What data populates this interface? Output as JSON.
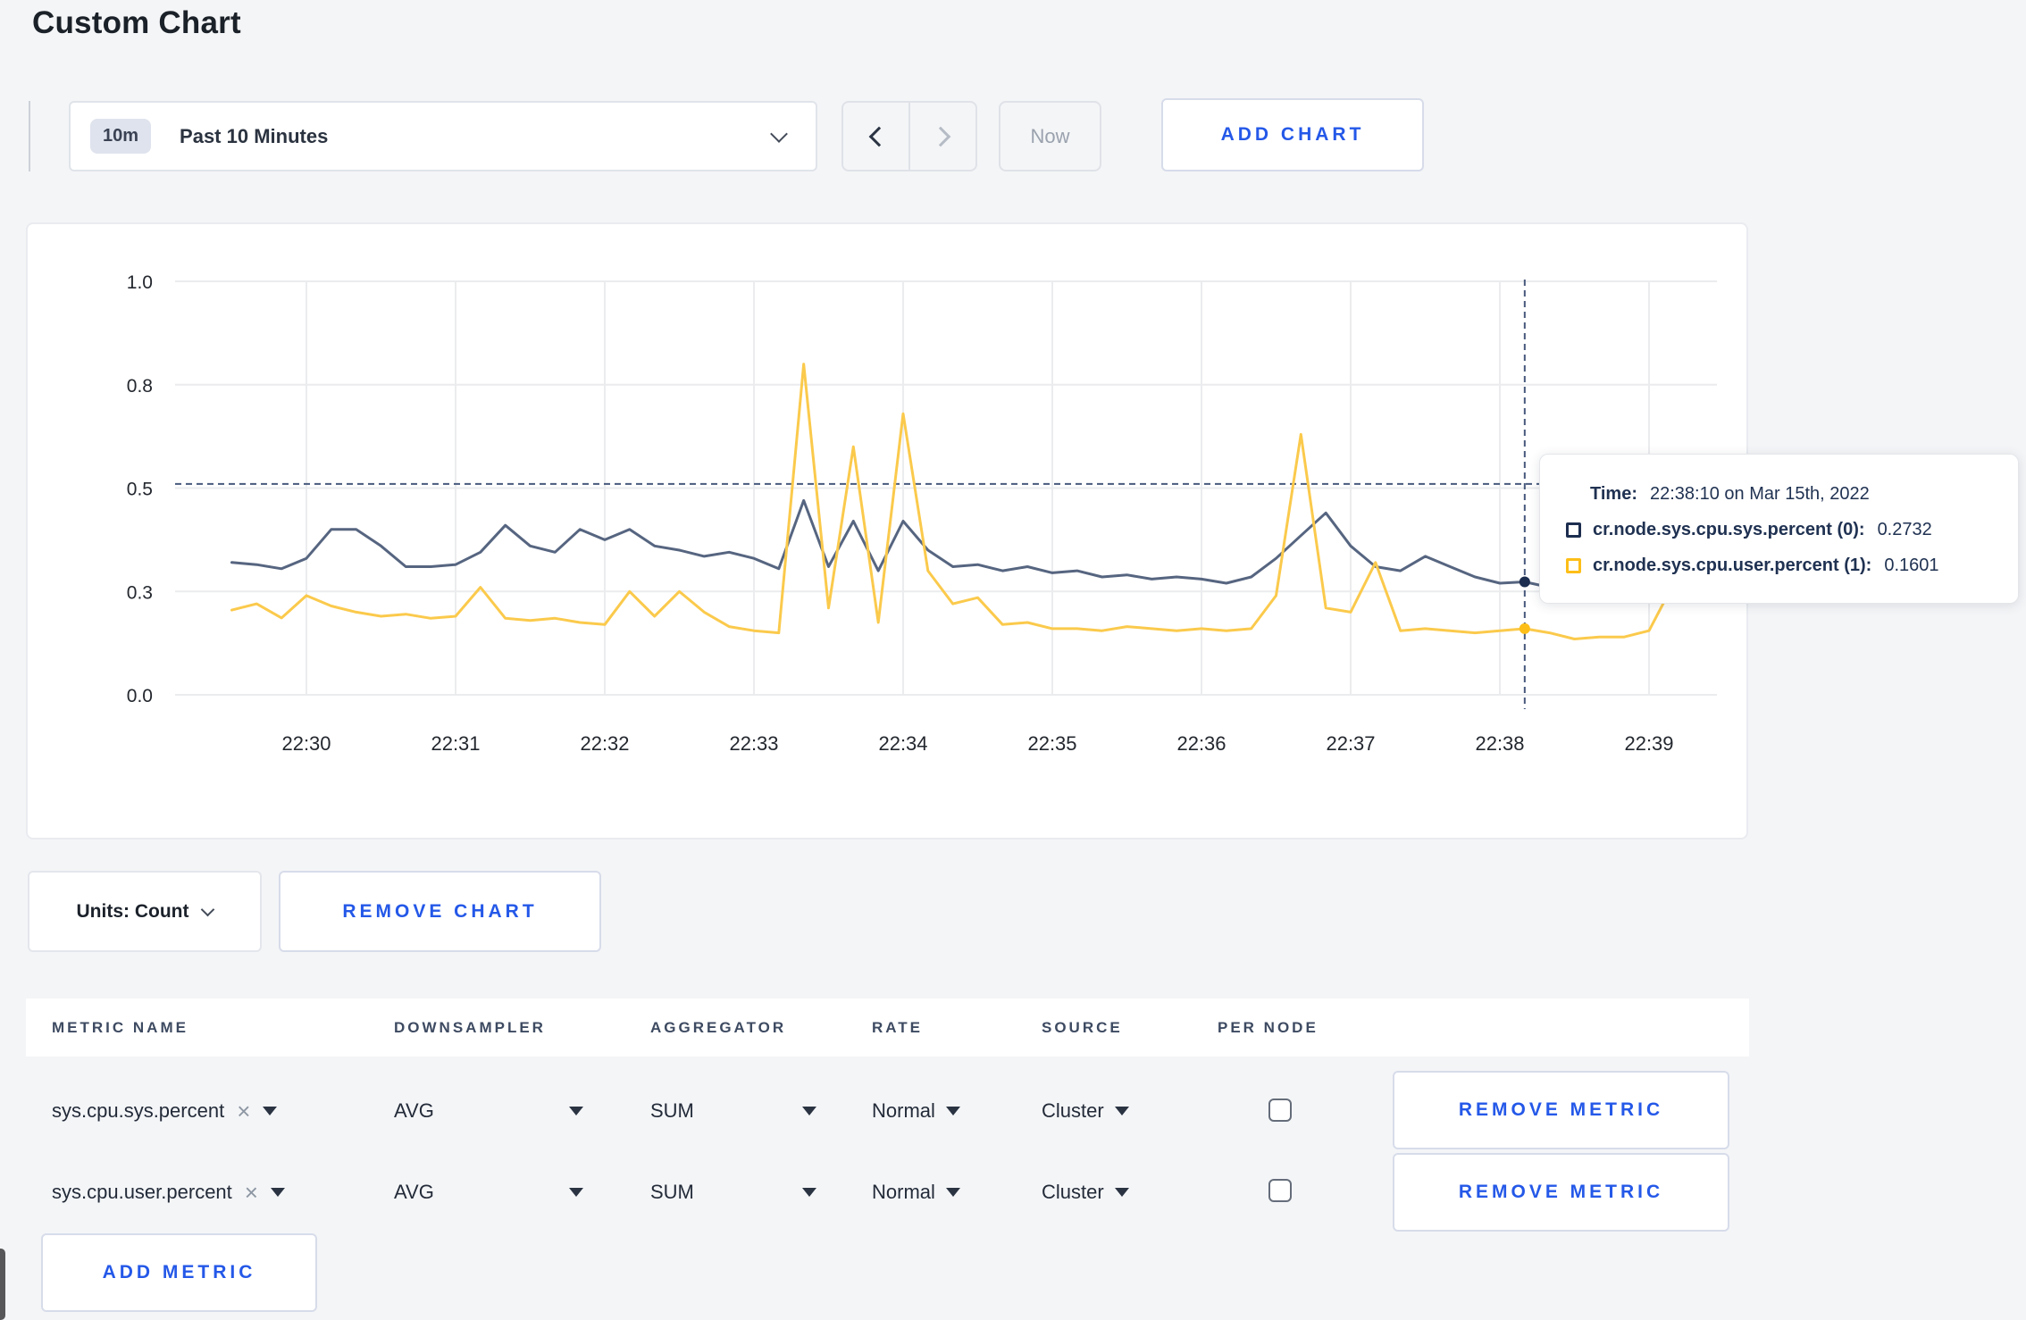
{
  "page": {
    "title": "Custom Chart"
  },
  "toolbar": {
    "time_range_badge": "10m",
    "time_range_label": "Past 10 Minutes",
    "now_label": "Now",
    "add_chart_label": "ADD CHART"
  },
  "chart_data": {
    "type": "line",
    "title": "",
    "xlabel": "",
    "ylabel": "",
    "x_start": "22:29:30",
    "x_step_seconds": 10,
    "x_tick_labels": [
      "22:30",
      "22:31",
      "22:32",
      "22:33",
      "22:34",
      "22:35",
      "22:36",
      "22:37",
      "22:38",
      "22:39"
    ],
    "y_tick_values": [
      0,
      0.25,
      0.5,
      0.75,
      1.0
    ],
    "y_tick_labels": [
      "0.0",
      "0.3",
      "0.5",
      "0.8",
      "1.0"
    ],
    "ylim": [
      0,
      1
    ],
    "grid": true,
    "legend_position": "tooltip",
    "series": [
      {
        "name": "cr.node.sys.cpu.sys.percent (0)",
        "color": "#566580",
        "swatch_color": "#1c2d4f",
        "values": [
          0.32,
          0.315,
          0.305,
          0.33,
          0.4,
          0.4,
          0.36,
          0.31,
          0.31,
          0.315,
          0.345,
          0.41,
          0.36,
          0.345,
          0.4,
          0.375,
          0.4,
          0.36,
          0.35,
          0.335,
          0.345,
          0.33,
          0.305,
          0.47,
          0.31,
          0.42,
          0.3,
          0.42,
          0.35,
          0.31,
          0.315,
          0.3,
          0.31,
          0.295,
          0.3,
          0.285,
          0.29,
          0.28,
          0.285,
          0.28,
          0.27,
          0.285,
          0.33,
          0.385,
          0.44,
          0.36,
          0.31,
          0.3,
          0.335,
          0.31,
          0.285,
          0.27,
          0.2732,
          0.26,
          0.285,
          0.31,
          0.28,
          0.285,
          0.305,
          0.295
        ]
      },
      {
        "name": "cr.node.sys.cpu.user.percent (1)",
        "color": "#fbca4c",
        "swatch_color": "#fdbe18",
        "values": [
          0.205,
          0.22,
          0.186,
          0.24,
          0.215,
          0.2,
          0.19,
          0.195,
          0.185,
          0.19,
          0.26,
          0.185,
          0.18,
          0.185,
          0.175,
          0.17,
          0.25,
          0.19,
          0.25,
          0.2,
          0.165,
          0.155,
          0.15,
          0.8,
          0.21,
          0.6,
          0.175,
          0.68,
          0.3,
          0.22,
          0.235,
          0.17,
          0.175,
          0.16,
          0.16,
          0.155,
          0.165,
          0.16,
          0.155,
          0.16,
          0.155,
          0.16,
          0.24,
          0.63,
          0.21,
          0.2,
          0.32,
          0.155,
          0.16,
          0.155,
          0.15,
          0.155,
          0.1601,
          0.15,
          0.135,
          0.14,
          0.14,
          0.155,
          0.27,
          0.235
        ]
      }
    ],
    "hover": {
      "index": 52,
      "time": "22:38:10 on Mar 15th, 2022",
      "crosshair_y_value": 0.51
    }
  },
  "tooltip": {
    "time_prefix": "Time:",
    "time_value": "22:38:10 on Mar 15th, 2022",
    "entries": [
      {
        "label": "cr.node.sys.cpu.sys.percent (0):",
        "value": "0.2732"
      },
      {
        "label": "cr.node.sys.cpu.user.percent (1):",
        "value": "0.1601"
      }
    ]
  },
  "chart_controls": {
    "units_label": "Units: Count",
    "remove_chart_label": "REMOVE CHART"
  },
  "metrics_table": {
    "headers": [
      "METRIC NAME",
      "DOWNSAMPLER",
      "AGGREGATOR",
      "RATE",
      "SOURCE",
      "PER NODE"
    ],
    "clear_icon_glyph": "×",
    "rows": [
      {
        "metric": "sys.cpu.sys.percent",
        "downsampler": "AVG",
        "aggregator": "SUM",
        "rate": "Normal",
        "source": "Cluster",
        "per_node_checked": false,
        "remove_label": "REMOVE METRIC"
      },
      {
        "metric": "sys.cpu.user.percent",
        "downsampler": "AVG",
        "aggregator": "SUM",
        "rate": "Normal",
        "source": "Cluster",
        "per_node_checked": false,
        "remove_label": "REMOVE METRIC"
      }
    ],
    "add_metric_label": "ADD METRIC"
  },
  "colors": {
    "accent_blue": "#2458e8",
    "background": "#f4f5f7",
    "grid_line": "#ebecee",
    "crosshair": "#47597c",
    "axis_text": "#23272e"
  }
}
